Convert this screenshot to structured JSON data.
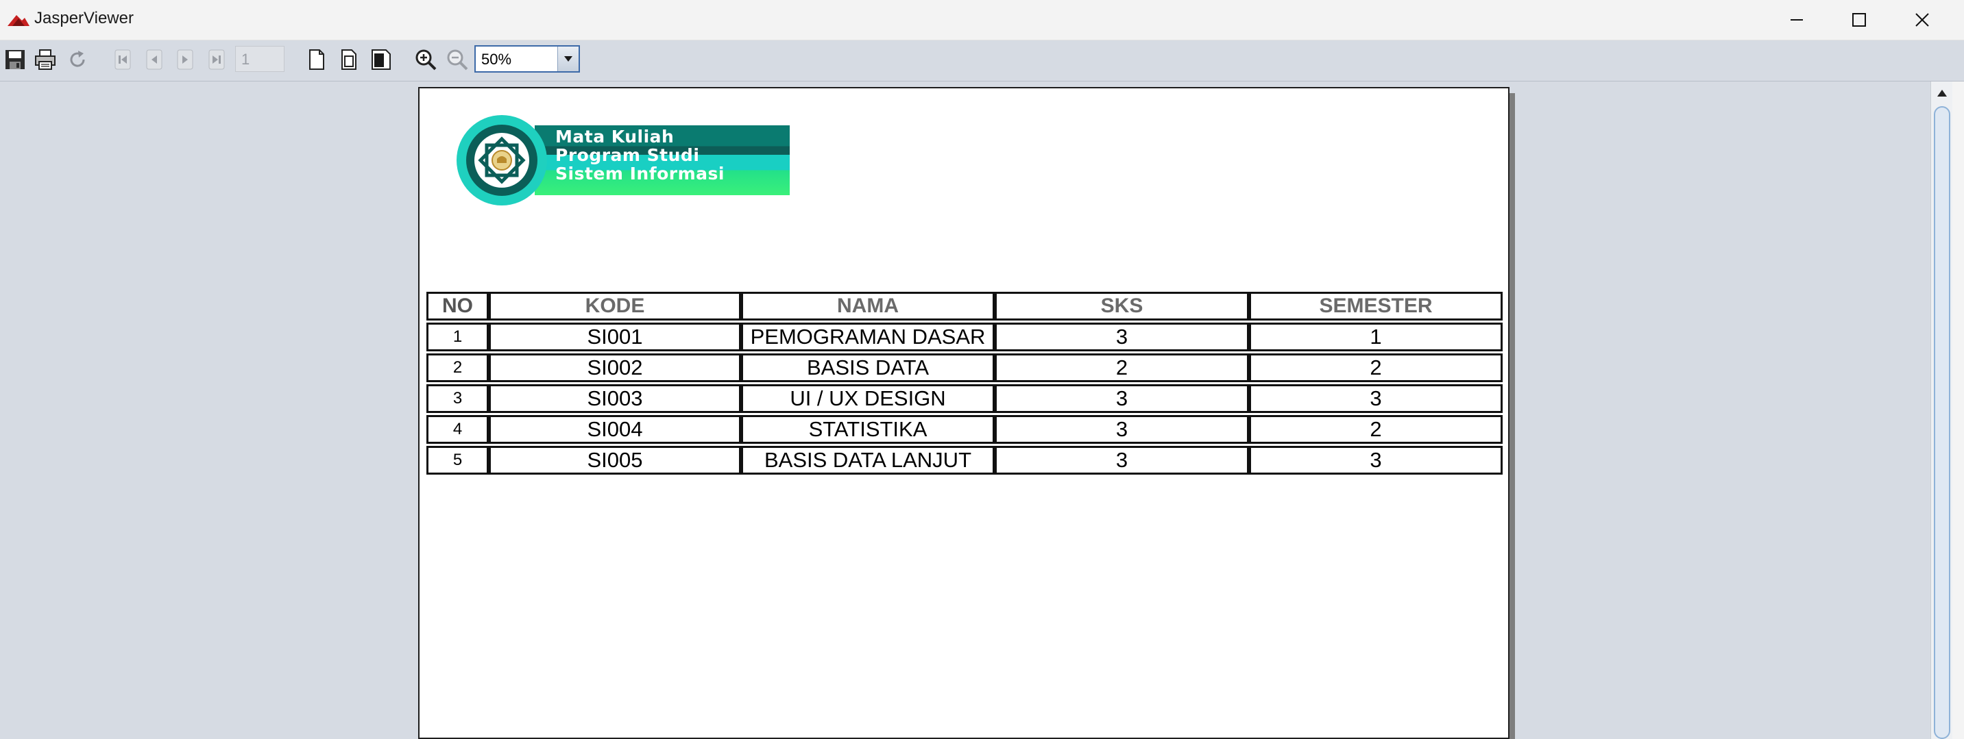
{
  "window": {
    "title": "JasperViewer",
    "controls": [
      "minimize-icon",
      "maximize-icon",
      "close-icon"
    ]
  },
  "toolbar": {
    "buttons": [
      "save-icon",
      "print-icon",
      "reload-icon",
      "first-page-icon",
      "previous-page-icon",
      "next-page-icon",
      "last-page-icon",
      "actual-size-icon",
      "fit-page-icon",
      "fit-width-icon",
      "zoom-in-icon",
      "zoom-out-icon"
    ],
    "page_number": "1",
    "zoom": "50%"
  },
  "report": {
    "logo": {
      "line1": "Mata Kuliah",
      "line2": "Program Studi",
      "line3": "Sistem Informasi",
      "colors": {
        "dark": "#0a7b70",
        "teal": "#19cfc3",
        "green": "#3af07a"
      }
    },
    "table": {
      "headers": [
        "NO",
        "KODE",
        "NAMA",
        "SKS",
        "SEMESTER"
      ],
      "rows": [
        [
          "1",
          "SI001",
          "PEMOGRAMAN DASAR",
          "3",
          "1"
        ],
        [
          "2",
          "SI002",
          "BASIS DATA",
          "2",
          "2"
        ],
        [
          "3",
          "SI003",
          "UI / UX DESIGN",
          "3",
          "3"
        ],
        [
          "4",
          "SI004",
          "STATISTIKA",
          "3",
          "2"
        ],
        [
          "5",
          "SI005",
          "BASIS DATA LANJUT",
          "3",
          "3"
        ]
      ]
    }
  }
}
